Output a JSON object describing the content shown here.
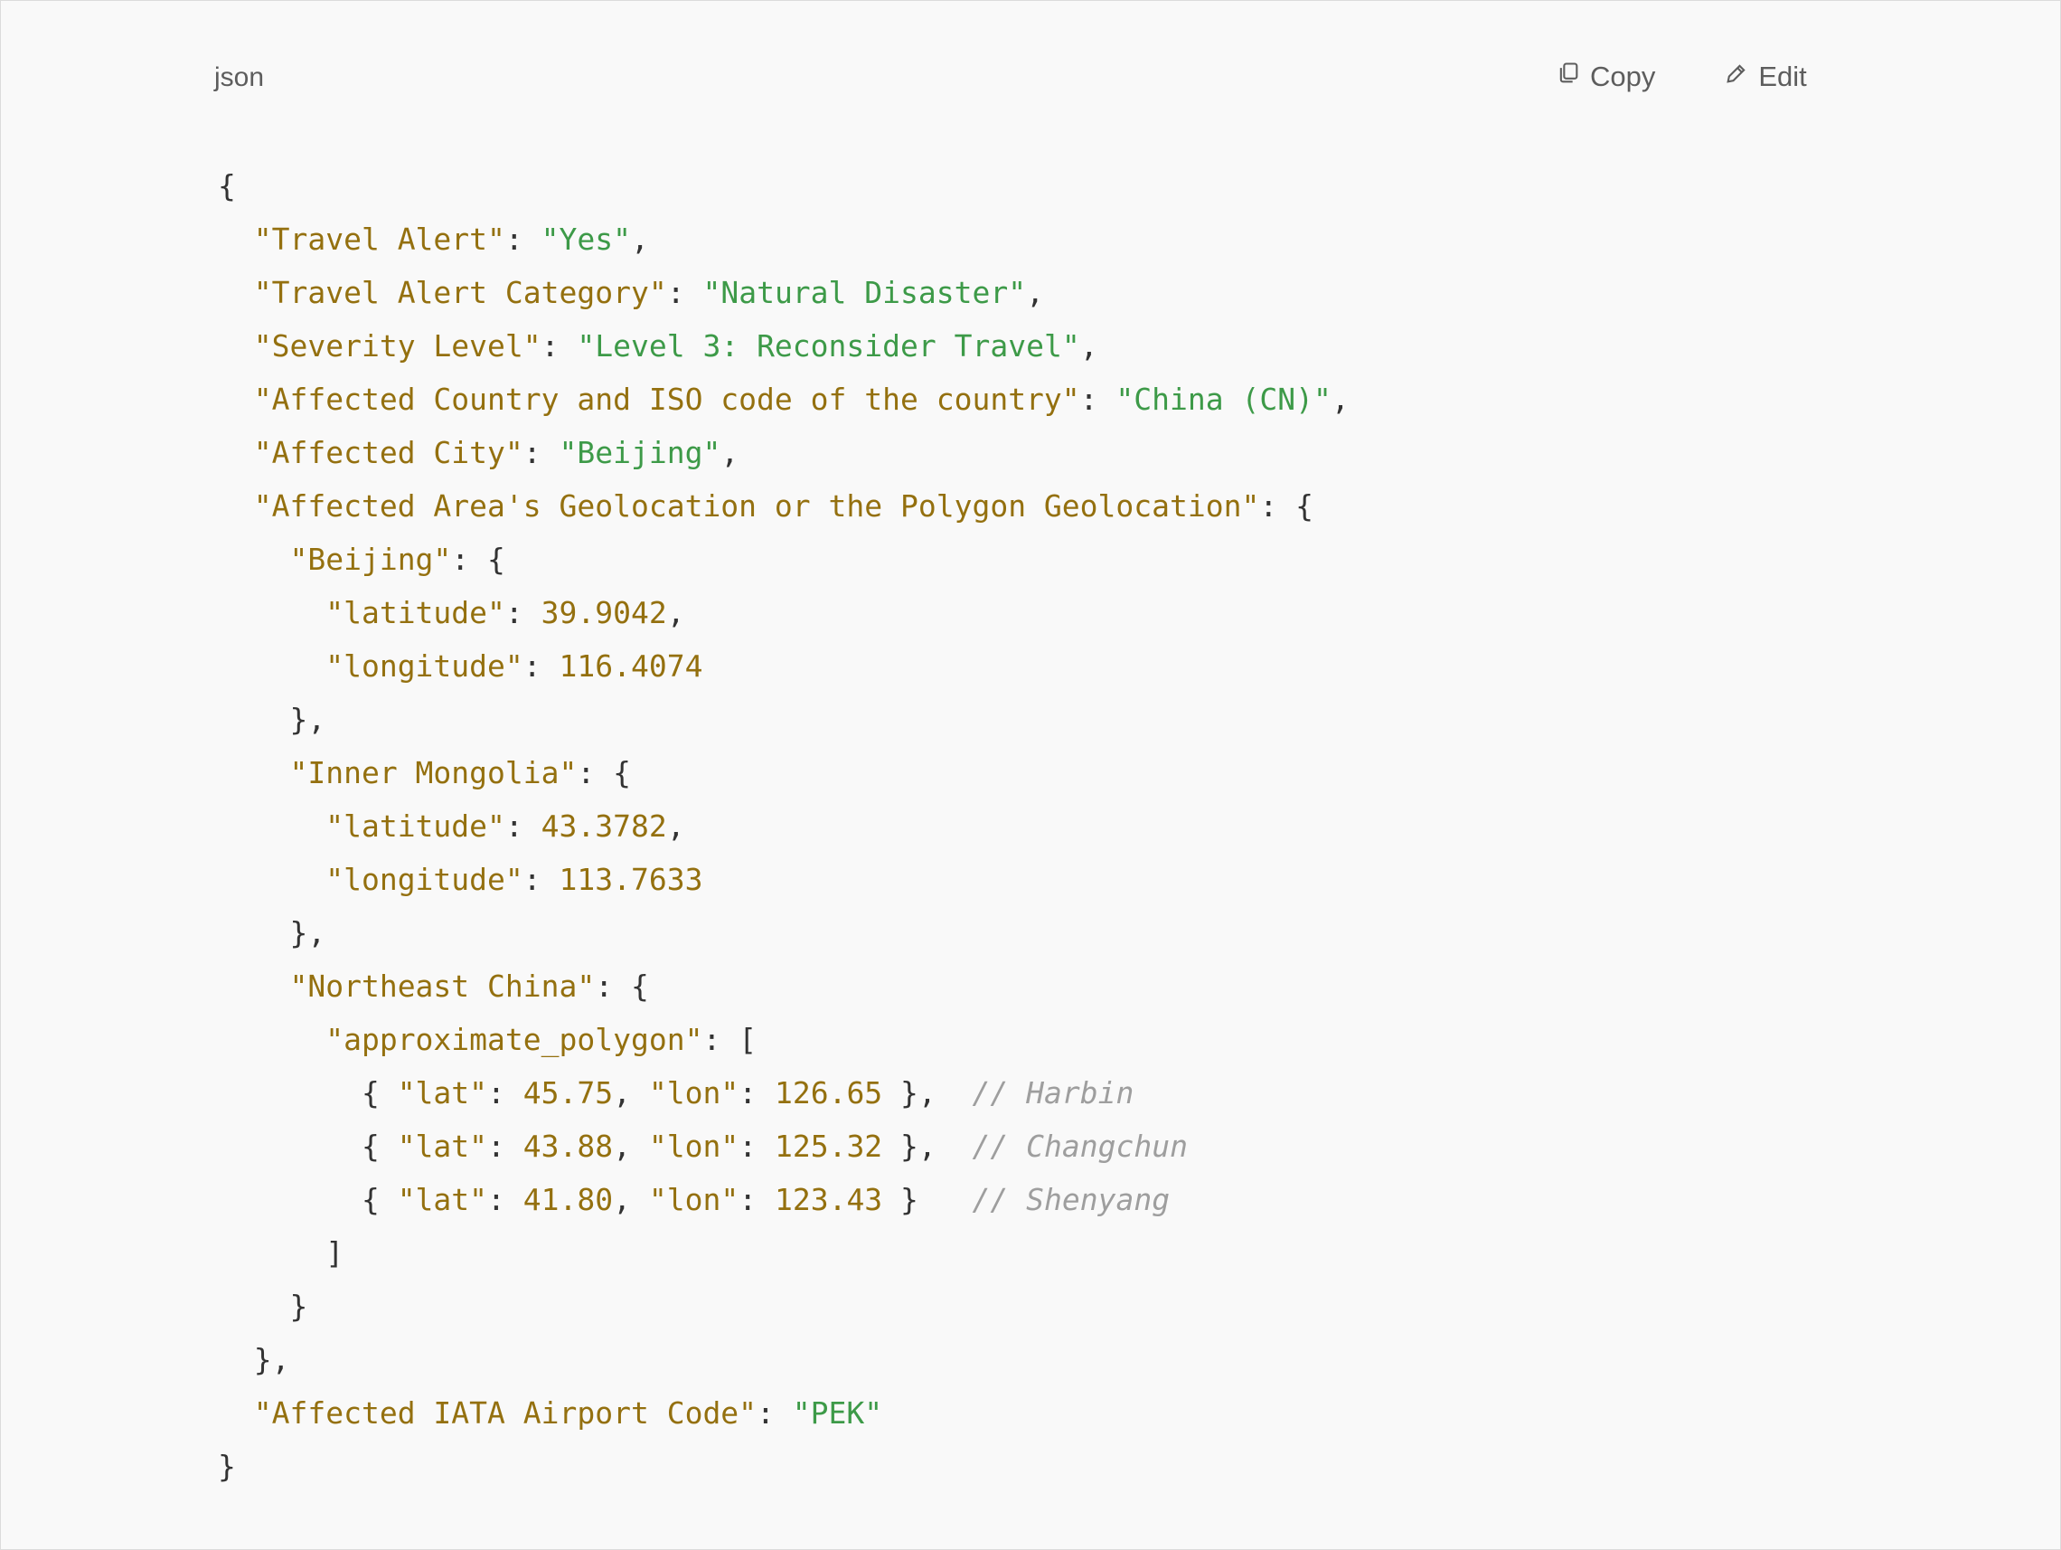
{
  "header": {
    "language": "json",
    "copy_label": "Copy",
    "edit_label": "Edit",
    "copy_icon": "copy-icon",
    "edit_icon": "pencil-icon"
  },
  "colors": {
    "background": "#f9f9f9",
    "key": "#94700f",
    "string": "#3d9a48",
    "number": "#94700f",
    "comment": "#9e9e9e",
    "punctuation": "#333333"
  },
  "code_lines": [
    [
      {
        "t": "p",
        "v": "{"
      }
    ],
    [
      {
        "t": "p",
        "v": "  "
      },
      {
        "t": "k",
        "v": "\"Travel Alert\""
      },
      {
        "t": "p",
        "v": ": "
      },
      {
        "t": "s",
        "v": "\"Yes\""
      },
      {
        "t": "p",
        "v": ","
      }
    ],
    [
      {
        "t": "p",
        "v": "  "
      },
      {
        "t": "k",
        "v": "\"Travel Alert Category\""
      },
      {
        "t": "p",
        "v": ": "
      },
      {
        "t": "s",
        "v": "\"Natural Disaster\""
      },
      {
        "t": "p",
        "v": ","
      }
    ],
    [
      {
        "t": "p",
        "v": "  "
      },
      {
        "t": "k",
        "v": "\"Severity Level\""
      },
      {
        "t": "p",
        "v": ": "
      },
      {
        "t": "s",
        "v": "\"Level 3: Reconsider Travel\""
      },
      {
        "t": "p",
        "v": ","
      }
    ],
    [
      {
        "t": "p",
        "v": "  "
      },
      {
        "t": "k",
        "v": "\"Affected Country and ISO code of the country\""
      },
      {
        "t": "p",
        "v": ": "
      },
      {
        "t": "s",
        "v": "\"China (CN)\""
      },
      {
        "t": "p",
        "v": ","
      }
    ],
    [
      {
        "t": "p",
        "v": "  "
      },
      {
        "t": "k",
        "v": "\"Affected City\""
      },
      {
        "t": "p",
        "v": ": "
      },
      {
        "t": "s",
        "v": "\"Beijing\""
      },
      {
        "t": "p",
        "v": ","
      }
    ],
    [
      {
        "t": "p",
        "v": "  "
      },
      {
        "t": "k",
        "v": "\"Affected Area's Geolocation or the Polygon Geolocation\""
      },
      {
        "t": "p",
        "v": ": {"
      }
    ],
    [
      {
        "t": "p",
        "v": "    "
      },
      {
        "t": "k",
        "v": "\"Beijing\""
      },
      {
        "t": "p",
        "v": ": {"
      }
    ],
    [
      {
        "t": "p",
        "v": "      "
      },
      {
        "t": "k",
        "v": "\"latitude\""
      },
      {
        "t": "p",
        "v": ": "
      },
      {
        "t": "n",
        "v": "39.9042"
      },
      {
        "t": "p",
        "v": ","
      }
    ],
    [
      {
        "t": "p",
        "v": "      "
      },
      {
        "t": "k",
        "v": "\"longitude\""
      },
      {
        "t": "p",
        "v": ": "
      },
      {
        "t": "n",
        "v": "116.4074"
      }
    ],
    [
      {
        "t": "p",
        "v": "    },"
      }
    ],
    [
      {
        "t": "p",
        "v": "    "
      },
      {
        "t": "k",
        "v": "\"Inner Mongolia\""
      },
      {
        "t": "p",
        "v": ": {"
      }
    ],
    [
      {
        "t": "p",
        "v": "      "
      },
      {
        "t": "k",
        "v": "\"latitude\""
      },
      {
        "t": "p",
        "v": ": "
      },
      {
        "t": "n",
        "v": "43.3782"
      },
      {
        "t": "p",
        "v": ","
      }
    ],
    [
      {
        "t": "p",
        "v": "      "
      },
      {
        "t": "k",
        "v": "\"longitude\""
      },
      {
        "t": "p",
        "v": ": "
      },
      {
        "t": "n",
        "v": "113.7633"
      }
    ],
    [
      {
        "t": "p",
        "v": "    },"
      }
    ],
    [
      {
        "t": "p",
        "v": "    "
      },
      {
        "t": "k",
        "v": "\"Northeast China\""
      },
      {
        "t": "p",
        "v": ": {"
      }
    ],
    [
      {
        "t": "p",
        "v": "      "
      },
      {
        "t": "k",
        "v": "\"approximate_polygon\""
      },
      {
        "t": "p",
        "v": ": ["
      }
    ],
    [
      {
        "t": "p",
        "v": "        { "
      },
      {
        "t": "k",
        "v": "\"lat\""
      },
      {
        "t": "p",
        "v": ": "
      },
      {
        "t": "n",
        "v": "45.75"
      },
      {
        "t": "p",
        "v": ", "
      },
      {
        "t": "k",
        "v": "\"lon\""
      },
      {
        "t": "p",
        "v": ": "
      },
      {
        "t": "n",
        "v": "126.65"
      },
      {
        "t": "p",
        "v": " },  "
      },
      {
        "t": "c",
        "v": "// Harbin"
      }
    ],
    [
      {
        "t": "p",
        "v": "        { "
      },
      {
        "t": "k",
        "v": "\"lat\""
      },
      {
        "t": "p",
        "v": ": "
      },
      {
        "t": "n",
        "v": "43.88"
      },
      {
        "t": "p",
        "v": ", "
      },
      {
        "t": "k",
        "v": "\"lon\""
      },
      {
        "t": "p",
        "v": ": "
      },
      {
        "t": "n",
        "v": "125.32"
      },
      {
        "t": "p",
        "v": " },  "
      },
      {
        "t": "c",
        "v": "// Changchun"
      }
    ],
    [
      {
        "t": "p",
        "v": "        { "
      },
      {
        "t": "k",
        "v": "\"lat\""
      },
      {
        "t": "p",
        "v": ": "
      },
      {
        "t": "n",
        "v": "41.80"
      },
      {
        "t": "p",
        "v": ", "
      },
      {
        "t": "k",
        "v": "\"lon\""
      },
      {
        "t": "p",
        "v": ": "
      },
      {
        "t": "n",
        "v": "123.43"
      },
      {
        "t": "p",
        "v": " }   "
      },
      {
        "t": "c",
        "v": "// Shenyang"
      }
    ],
    [
      {
        "t": "p",
        "v": "      ]"
      }
    ],
    [
      {
        "t": "p",
        "v": "    }"
      }
    ],
    [
      {
        "t": "p",
        "v": "  },"
      }
    ],
    [
      {
        "t": "p",
        "v": "  "
      },
      {
        "t": "k",
        "v": "\"Affected IATA Airport Code\""
      },
      {
        "t": "p",
        "v": ": "
      },
      {
        "t": "s",
        "v": "\"PEK\""
      }
    ],
    [
      {
        "t": "p",
        "v": "}"
      }
    ]
  ]
}
